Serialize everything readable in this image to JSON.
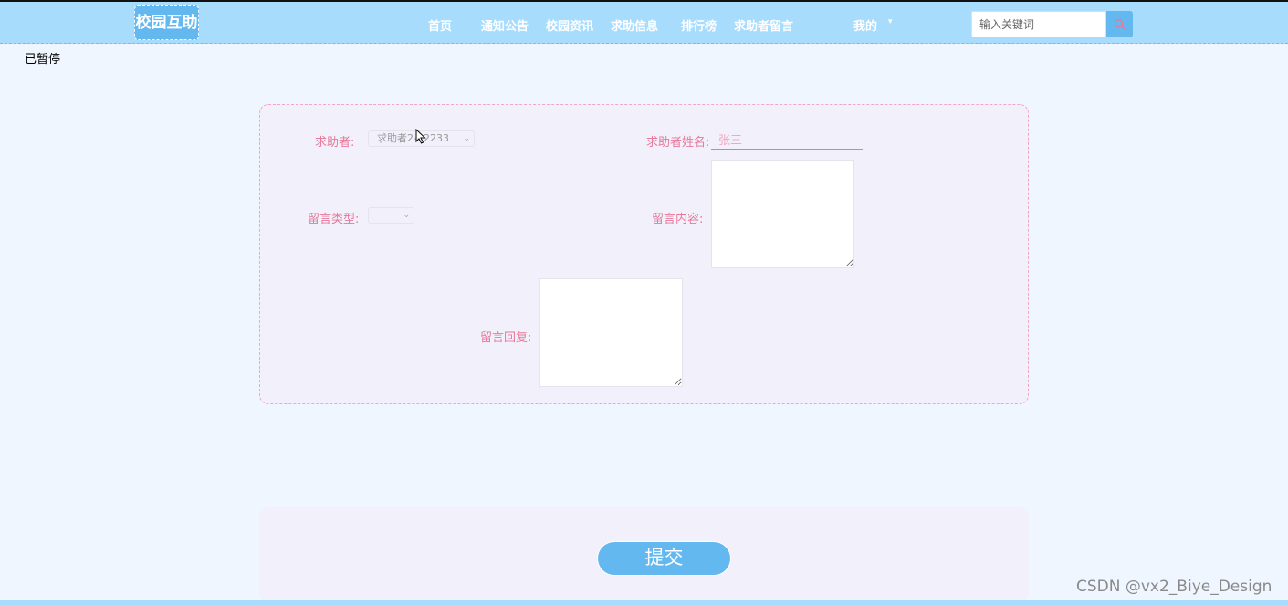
{
  "header": {
    "logo": "校园互助",
    "nav": [
      {
        "label": "首页"
      },
      {
        "label": "通知公告"
      },
      {
        "label": "校园资讯"
      },
      {
        "label": "求助信息"
      },
      {
        "label": "排行榜"
      },
      {
        "label": "求助者留言"
      },
      {
        "label": "我的"
      }
    ],
    "dropdown_caret": "▾",
    "search": {
      "placeholder": "输入关键词",
      "icon": "search-icon"
    }
  },
  "status": {
    "paused_text": "已暂停"
  },
  "form": {
    "helper_label": "求助者:",
    "helper_select_value": "求助者2-12233",
    "helper_name_label": "求助者姓名:",
    "helper_name_value": "张三",
    "message_type_label": "留言类型:",
    "message_type_value": "",
    "message_content_label": "留言内容:",
    "message_reply_label": "留言回复:"
  },
  "submit": {
    "label": "提交"
  },
  "watermark": "CSDN @vx2_Biye_Design",
  "colors": {
    "nav_bg": "#a8dcfd",
    "accent_blue": "#63b8f0",
    "label_pink": "#e8799a",
    "card_bg": "#f1f0fb",
    "page_bg": "#f0f6ff"
  }
}
